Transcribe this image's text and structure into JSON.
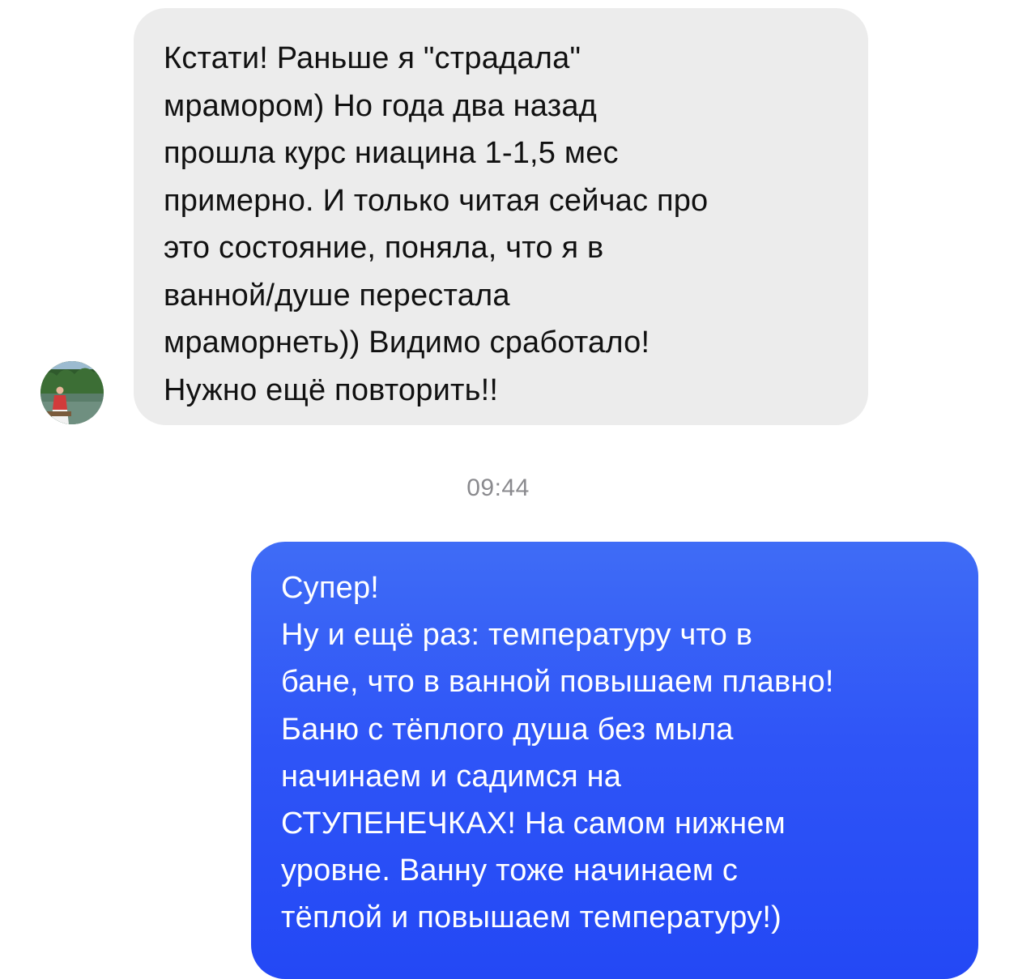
{
  "conversation": {
    "incoming_message": {
      "lines": [
        "Кстати! Раньше я \"страдала\"",
        "мрамором) Но года два назад",
        "прошла курс ниацина 1-1,5 мес",
        "примерно. И только читая сейчас про",
        "это состояние, поняла, что я в",
        "ванной/душе перестала",
        "мраморнеть)) Видимо сработало!",
        "Нужно ещё повторить!!"
      ]
    },
    "timestamp": "09:44",
    "outgoing_message": {
      "lines": [
        "Супер!",
        "Ну и ещё раз: температуру что в",
        "бане, что в ванной повышаем плавно!",
        "Баню с тёплого душа без мыла",
        "начинаем и садимся на",
        "СТУПЕНЕЧКАХ! На самом нижнем",
        "уровне. Ванну тоже начинаем с",
        "тёплой и повышаем температуру!)"
      ]
    }
  },
  "colors": {
    "incoming_bubble": "#ececec",
    "outgoing_bubble": "#2f55f7",
    "timestamp": "#8a8a8e"
  },
  "icons": {
    "avatar": "user-avatar-photo"
  }
}
